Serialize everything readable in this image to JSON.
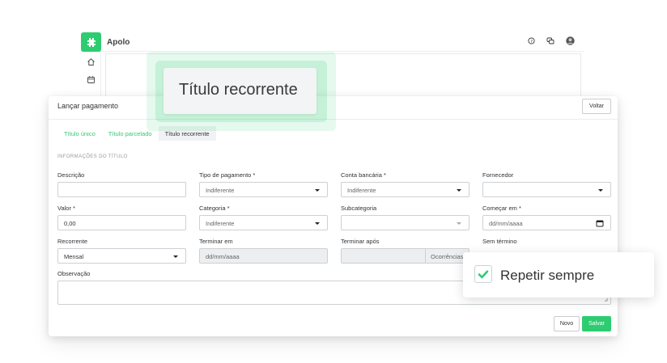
{
  "app": {
    "name": "Apolo",
    "icons": [
      "puzzle-logo-icon",
      "help-icon",
      "chat-icon",
      "avatar"
    ],
    "sidebar_icons": [
      "home-icon",
      "calendar-icon"
    ]
  },
  "modal": {
    "title": "Lançar pagamento",
    "back_button": "Voltar",
    "tabs": [
      {
        "label": "Título único",
        "active": false
      },
      {
        "label": "Título parcelado",
        "active": false
      },
      {
        "label": "Título recorrente",
        "active": true
      }
    ],
    "section_heading": "INFORMAÇÕES DO TÍTULO",
    "fields": {
      "descricao": {
        "label": "Descrição",
        "value": ""
      },
      "tipo_pagamento": {
        "label": "Tipo de pagamento *",
        "value": "Indiferente"
      },
      "conta_bancaria": {
        "label": "Conta bancária *",
        "value": "Indiferente"
      },
      "fornecedor": {
        "label": "Fornecedor",
        "value": ""
      },
      "valor": {
        "label": "Valor *",
        "value": "0,00"
      },
      "categoria": {
        "label": "Categoria *",
        "value": "Indiferente"
      },
      "subcategoria": {
        "label": "Subcategoria",
        "value": ""
      },
      "comecar_em": {
        "label": "Começar em *",
        "value": "dd/mm/aaaa"
      },
      "recorrente": {
        "label": "Recorrente",
        "value": "Mensal"
      },
      "terminar_em": {
        "label": "Terminar em",
        "value": "dd/mm/aaaa"
      },
      "terminar_apos": {
        "label": "Terminar após",
        "value": "",
        "addon": "Ocorrências"
      },
      "sem_termino": {
        "label": "Sem término"
      },
      "observacao": {
        "label": "Observação",
        "value": ""
      }
    },
    "new_button": "Novo",
    "save_button": "Salvar"
  },
  "callouts": {
    "title": "Título recorrente",
    "repeat_label": "Repetir sempre",
    "repeat_checked": true
  },
  "colors": {
    "accent": "#2ecc71",
    "disabled_bg": "#eceeef",
    "border": "#ccd1d5"
  }
}
